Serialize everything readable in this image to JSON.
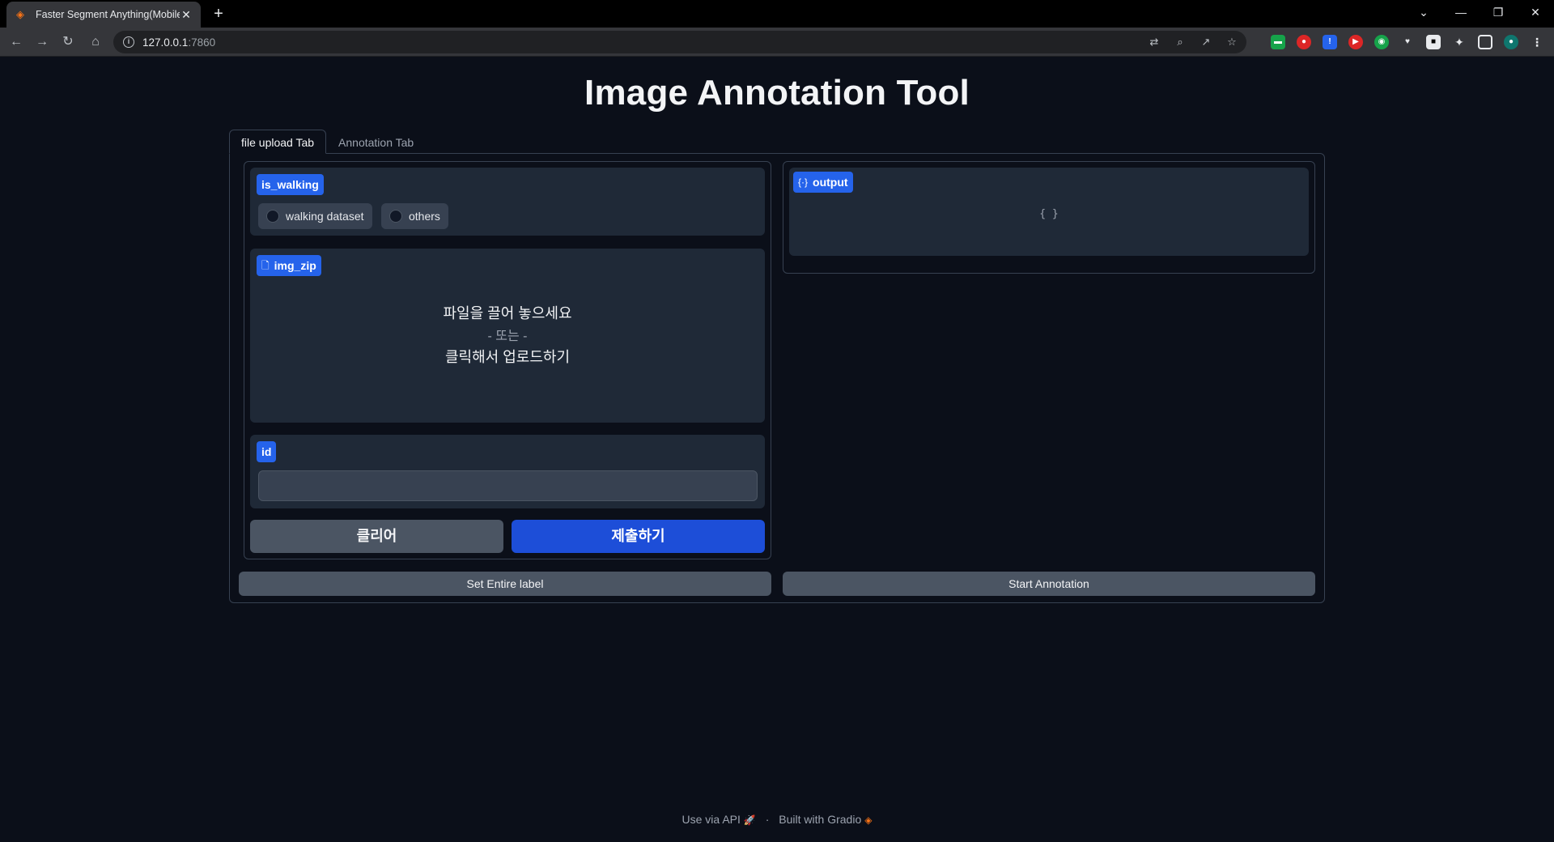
{
  "browser": {
    "tab_title": "Faster Segment Anything(MobileSAM)",
    "tab_icon": "gradio-logo-icon",
    "url_host": "127.0.0.1",
    "url_port": ":7860"
  },
  "app": {
    "title": "Image Annotation Tool",
    "tabs": [
      {
        "label": "file upload Tab",
        "active": true
      },
      {
        "label": "Annotation Tab",
        "active": false
      }
    ],
    "is_walking": {
      "label": "is_walking",
      "options": [
        "walking dataset",
        "others"
      ],
      "selected": null
    },
    "img_zip": {
      "label": "img_zip",
      "drop_text": "파일을 끌어 놓으세요",
      "or_text": "- 또는 -",
      "click_text": "클릭해서 업로드하기"
    },
    "id_field": {
      "label": "id",
      "value": "",
      "placeholder": ""
    },
    "buttons": {
      "clear": "클리어",
      "submit": "제출하기",
      "set_entire_label": "Set Entire label",
      "start_annotation": "Start Annotation"
    },
    "output": {
      "label": "output",
      "value": "{ }"
    },
    "footer": {
      "api": "Use via API",
      "separator": "·",
      "built_with": "Built with Gradio"
    }
  },
  "colors": {
    "background": "#0b0f19",
    "panel": "#1f2937",
    "accent": "#2563eb",
    "primary_button": "#1d4ed8",
    "secondary_button": "#4b5563"
  }
}
